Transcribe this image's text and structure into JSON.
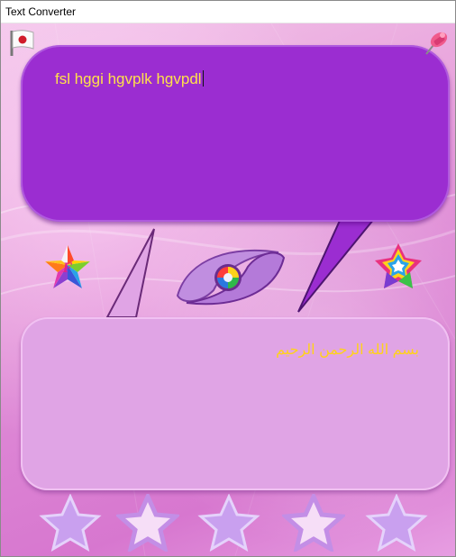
{
  "window": {
    "title": "Text Converter"
  },
  "input": {
    "text": "fsl hggi hgvplk hgvpdl"
  },
  "output": {
    "text": "بسم الله الرحمن الرحيم"
  },
  "icons": {
    "top_left": "japan-flag-icon",
    "top_right": "pushpin-icon",
    "left": "font-star-icon",
    "center": "convert-eye-icon",
    "right": "color-star-icon"
  },
  "colors": {
    "input_bubble": "#9b2dd1",
    "output_bubble": "#e0a4e5",
    "text_yellow": "#ffe14a",
    "star_fill": "#c9a0ef"
  },
  "stars": [
    "star-1",
    "star-2",
    "star-3",
    "star-4",
    "star-5"
  ]
}
